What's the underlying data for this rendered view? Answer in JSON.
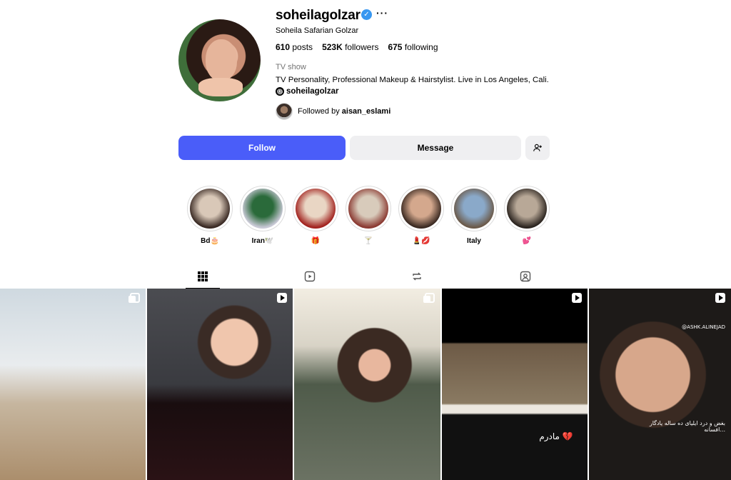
{
  "profile": {
    "username": "soheilagolzar",
    "verified_glyph": "✓",
    "more_glyph": "···",
    "full_name": "Soheila Safarian Golzar",
    "stats": {
      "posts_count": "610",
      "posts_label": "posts",
      "followers_count": "523K",
      "followers_label": "followers",
      "following_count": "675",
      "following_label": "following"
    },
    "category": "TV show",
    "bio": "TV Personality, Professional Makeup & Hairstylist. Live in Los Angeles, Cali.",
    "threads_handle": "soheilagolzar",
    "followed_by_prefix": "Followed by",
    "followed_by_user": "aisan_eslami"
  },
  "actions": {
    "follow": "Follow",
    "message": "Message",
    "add_user_glyph": "+👤"
  },
  "highlights": [
    {
      "label": "Bd🎂",
      "colors": [
        "#d9c8b8",
        "#3a2a24"
      ]
    },
    {
      "label": "Iran🕊️",
      "colors": [
        "#2a6a3a",
        "#c9c9d6"
      ]
    },
    {
      "label": "🎁",
      "colors": [
        "#e9d6c4",
        "#a2231f"
      ]
    },
    {
      "label": "🍸",
      "colors": [
        "#d8cbbb",
        "#8b3a32"
      ]
    },
    {
      "label": "💄💋",
      "colors": [
        "#d4a88d",
        "#3b2a22"
      ]
    },
    {
      "label": "Italy",
      "colors": [
        "#8aa9c9",
        "#6b5a4a"
      ]
    },
    {
      "label": "💕",
      "colors": [
        "#b8a897",
        "#2b241f"
      ]
    }
  ],
  "tabs": [
    {
      "name": "posts",
      "icon": "grid-icon"
    },
    {
      "name": "reels",
      "icon": "reels-icon"
    },
    {
      "name": "reposts",
      "icon": "repost-icon"
    },
    {
      "name": "tagged",
      "icon": "tagged-icon"
    }
  ],
  "posts": [
    {
      "type": "multi",
      "overlay": ""
    },
    {
      "type": "reel",
      "overlay": ""
    },
    {
      "type": "multi",
      "overlay": ""
    },
    {
      "type": "reel",
      "overlay": "مادرم 💔"
    },
    {
      "type": "reel",
      "overlay": "بغض و درد ایلیای ده ساله یادگار افسانه..."
    }
  ],
  "post5_watermark": "@ASHK.ALINEJAD"
}
